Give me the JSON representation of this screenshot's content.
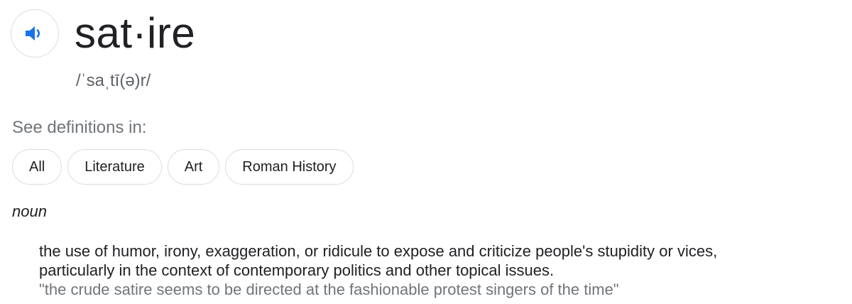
{
  "entry": {
    "word": "sat·ire",
    "phonetic": "/ˈsaˌtī(ə)r/",
    "audio_icon": "speaker-icon",
    "accent_color": "#1a73e8"
  },
  "see_definitions": {
    "label": "See definitions in:",
    "chips": [
      "All",
      "Literature",
      "Art",
      "Roman History"
    ]
  },
  "sense": {
    "part_of_speech": "noun",
    "definition_line1": "the use of humor, irony, exaggeration, or ridicule to expose and criticize people's stupidity or vices,",
    "definition_line2": "particularly in the context of contemporary politics and other topical issues.",
    "example": "\"the crude satire seems to be directed at the fashionable protest singers of the time\""
  }
}
